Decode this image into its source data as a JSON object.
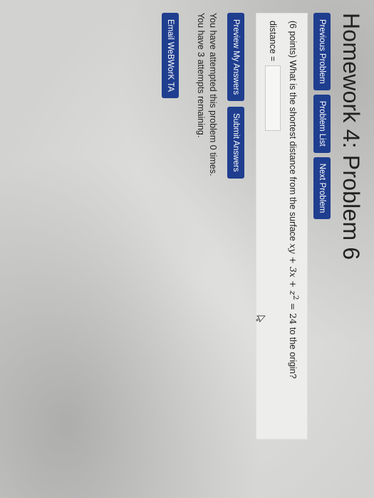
{
  "page": {
    "title": "Homework 4: Problem 6"
  },
  "nav": {
    "previous": "Previous Problem",
    "list": "Problem List",
    "next": "Next Problem"
  },
  "problem": {
    "points": "(6 points)",
    "question_before": "What is the shortest distance from the surface",
    "equation": {
      "t1": "xy",
      "op1": "+",
      "t2": "3x",
      "op2": "+",
      "t3": "z",
      "exp": "2",
      "op3": "=",
      "rhs": "24"
    },
    "question_after": "to the origin?",
    "answer_label": "distance =",
    "answer_value": ""
  },
  "actions": {
    "preview": "Preview My Answers",
    "submit": "Submit Answers"
  },
  "status": {
    "attempted": "You have attempted this problem 0 times.",
    "remaining": "You have 3 attempts remaining."
  },
  "footer": {
    "email": "Email WeBWorK TA"
  },
  "icons": {
    "cursor": "mouse-pointer-icon"
  },
  "colors": {
    "button": "#1f3e8f",
    "box_background": "#ededeb"
  }
}
